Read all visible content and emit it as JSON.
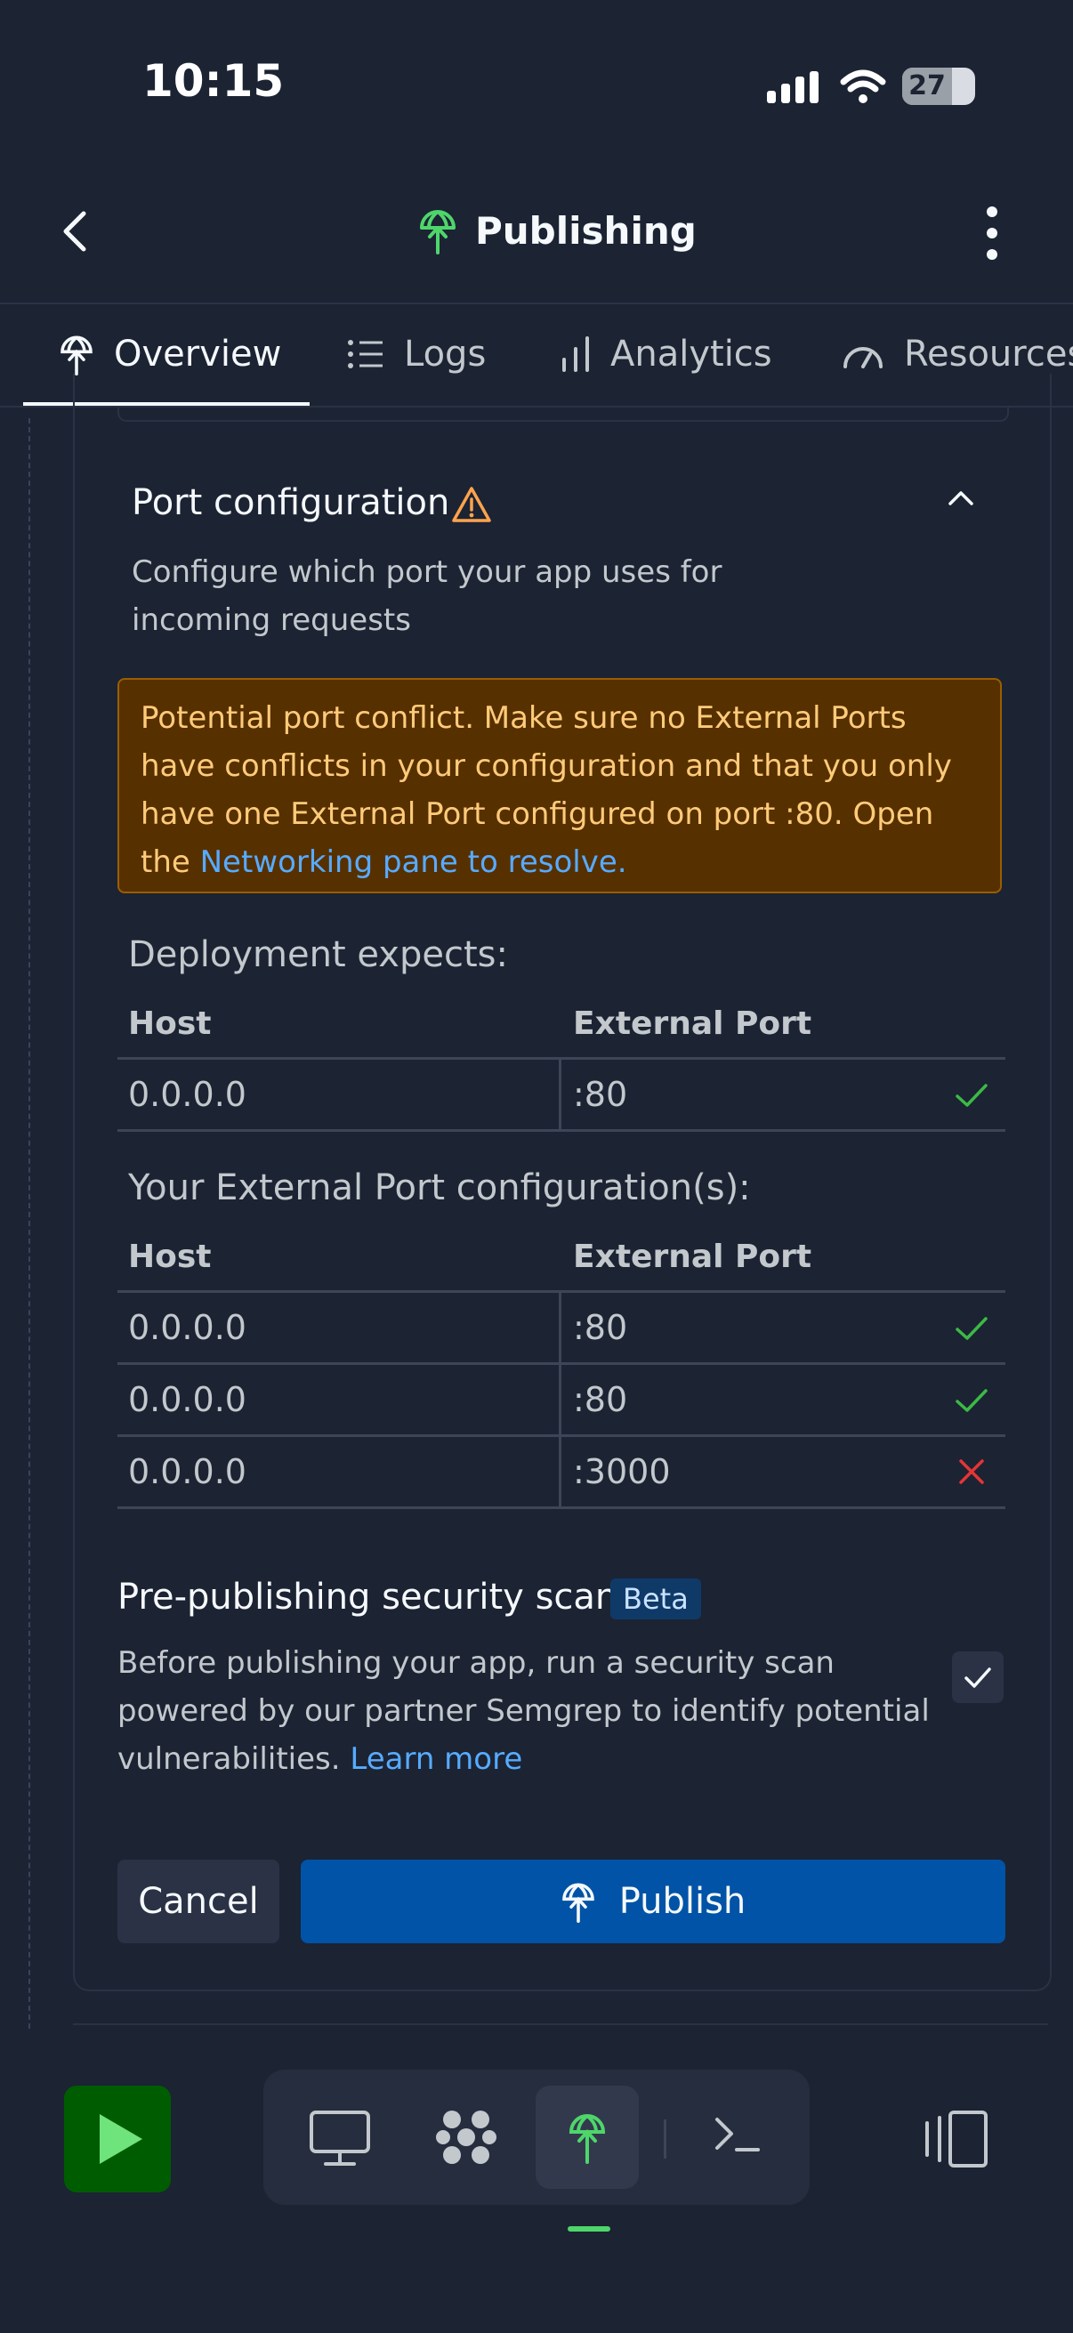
{
  "status_bar": {
    "time": "10:15",
    "battery": "27"
  },
  "header": {
    "title": "Publishing"
  },
  "tabs": [
    {
      "label": "Overview"
    },
    {
      "label": "Logs"
    },
    {
      "label": "Analytics"
    },
    {
      "label": "Resources"
    }
  ],
  "port_config": {
    "title": "Port configuration",
    "description": "Configure which port your app uses for incoming requests",
    "alert_text": "Potential port conflict. Make sure no External Ports have conflicts in your configuration and that you only have one External Port configured on port :80. Open the ",
    "alert_link": "Networking pane to resolve."
  },
  "deployment_expects": {
    "label": "Deployment expects:",
    "headers": [
      "Host",
      "External Port"
    ],
    "rows": [
      {
        "host": "0.0.0.0",
        "port": ":80",
        "status": "ok"
      }
    ]
  },
  "external_configs": {
    "label": "Your External Port configuration(s):",
    "headers": [
      "Host",
      "External Port"
    ],
    "rows": [
      {
        "host": "0.0.0.0",
        "port": ":80",
        "status": "ok"
      },
      {
        "host": "0.0.0.0",
        "port": ":80",
        "status": "ok"
      },
      {
        "host": "0.0.0.0",
        "port": ":3000",
        "status": "error"
      }
    ]
  },
  "security_scan": {
    "title": "Pre-publishing security scan",
    "badge": "Beta",
    "description": "Before publishing your app, run a security scan powered by our partner Semgrep to identify potential vulnerabilities. ",
    "link": "Learn more",
    "checked": true
  },
  "actions": {
    "cancel": "Cancel",
    "publish": "Publish"
  },
  "colors": {
    "accent": "#0053a6",
    "success": "#3bba45",
    "error": "#e53535",
    "warning": "#ffa34d",
    "publishing_green": "#4ed66b"
  },
  "icons": {
    "status": [
      "signal-icon",
      "wifi-icon",
      "battery-icon"
    ],
    "tabs": [
      "publishing-icon",
      "logs-icon",
      "analytics-icon",
      "gauge-icon"
    ],
    "dock": [
      "desktop-icon",
      "packages-icon",
      "publishing-icon",
      "shell-icon"
    ]
  }
}
